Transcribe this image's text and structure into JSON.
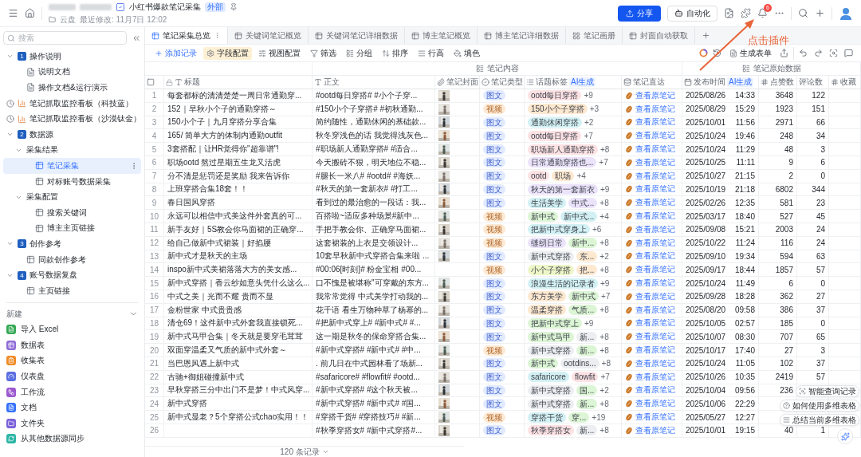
{
  "header": {
    "title": "小红书爆款笔记采集",
    "badge": "外部",
    "location": "云盘",
    "modified": "最近修改: 11月7日 12:02",
    "share": "分享",
    "automation": "自动化",
    "notifications": "6"
  },
  "annotation": {
    "text": "点击插件"
  },
  "sidebar": {
    "search": {
      "placeholder": "搜索"
    },
    "tree": [
      {
        "kind": "section",
        "number": "1",
        "label": "操作说明",
        "expanded": true,
        "selected": false,
        "children": [
          {
            "kind": "doc",
            "label": "说明文档",
            "selected": false
          },
          {
            "kind": "doc",
            "label": "操作文档&运行演示",
            "selected": false
          }
        ]
      },
      {
        "kind": "dashboard",
        "label": "笔记抓取监控看板（科技蓝）",
        "selected": false
      },
      {
        "kind": "dashboard",
        "label": "笔记抓取监控看板（沙漠钛金）",
        "selected": false
      },
      {
        "kind": "section",
        "number": "2",
        "label": "数据源",
        "expanded": true,
        "selected": false,
        "children": [
          {
            "kind": "folder",
            "label": "采集结果",
            "expanded": true,
            "selected": false,
            "children": [
              {
                "kind": "table",
                "label": "笔记采集",
                "selected": true
              },
              {
                "kind": "table",
                "label": "对标账号数据采集",
                "selected": false
              }
            ]
          },
          {
            "kind": "folder",
            "label": "采集配置",
            "expanded": true,
            "selected": false,
            "children": [
              {
                "kind": "table",
                "label": "搜索关键词",
                "selected": false
              },
              {
                "kind": "table",
                "label": "博主主页链接",
                "selected": false
              }
            ]
          }
        ]
      },
      {
        "kind": "section",
        "number": "3",
        "label": "创作参考",
        "expanded": true,
        "selected": false,
        "children": [
          {
            "kind": "table",
            "label": "同款创作参考",
            "selected": false
          }
        ]
      },
      {
        "kind": "section",
        "number": "4",
        "label": "账号数据复盘",
        "expanded": true,
        "selected": false,
        "children": [
          {
            "kind": "table",
            "label": "主页链接",
            "selected": false
          }
        ]
      }
    ],
    "new_section": {
      "title": "新建",
      "items": [
        {
          "kind": "excel",
          "label": "导入 Excel",
          "color": "#34a853"
        },
        {
          "kind": "table",
          "label": "数据表",
          "color": "#8e6bd8"
        },
        {
          "kind": "form",
          "label": "收集表",
          "color": "#f08a24"
        },
        {
          "kind": "dashboard",
          "label": "仪表盘",
          "color": "#5b6ee1"
        },
        {
          "kind": "workflow",
          "label": "工作流",
          "color": "#9b59d0"
        },
        {
          "kind": "doc",
          "label": "文档",
          "color": "#3370ff"
        },
        {
          "kind": "folder",
          "label": "文件夹",
          "color": "#7b61d9"
        },
        {
          "kind": "sync",
          "label": "从其他数据源同步",
          "color": "#2bb5a5"
        }
      ]
    }
  },
  "tabs": [
    {
      "kind": "table",
      "label": "笔记采集总览",
      "selected": true
    },
    {
      "kind": "table",
      "label": "关键词笔记概览",
      "selected": false
    },
    {
      "kind": "table",
      "label": "关键词笔记详细数据",
      "selected": false
    },
    {
      "kind": "table",
      "label": "博主笔记概览",
      "selected": false
    },
    {
      "kind": "table",
      "label": "博主笔记详细数据",
      "selected": false
    },
    {
      "kind": "gallery",
      "label": "笔记画册",
      "selected": false
    },
    {
      "kind": "table",
      "label": "封面自动获取",
      "selected": false
    }
  ],
  "toolbar": {
    "items": [
      {
        "kind": "add",
        "label": "添加记录",
        "active": false
      },
      {
        "kind": "fields",
        "label": "字段配置",
        "active": true
      },
      {
        "kind": "view",
        "label": "视图配置",
        "active": false
      },
      {
        "kind": "filter",
        "label": "筛选",
        "active": false
      },
      {
        "kind": "group",
        "label": "分组",
        "active": false
      },
      {
        "kind": "sort",
        "label": "排序",
        "active": false
      },
      {
        "kind": "row_height",
        "label": "行高",
        "active": false
      },
      {
        "kind": "fill",
        "label": "填色",
        "active": false
      }
    ],
    "generate_form": "生成表单"
  },
  "table": {
    "header_checkbox": {
      "checked": false
    },
    "groups": [
      {
        "label": "笔记内容"
      },
      {
        "label": "笔记原始数据"
      }
    ],
    "columns": [
      {
        "kind": "title",
        "label": "标题"
      },
      {
        "kind": "text",
        "label": "正文"
      },
      {
        "kind": "attachment",
        "label": "笔记封面"
      },
      {
        "kind": "select",
        "label": "笔记类型"
      },
      {
        "kind": "multi",
        "label": "话题标签",
        "ai": "AI生成"
      },
      {
        "kind": "formula",
        "label": "笔记直达"
      },
      {
        "kind": "date",
        "label": "发布时间",
        "ai": "AI生成"
      },
      {
        "kind": "number",
        "label": "点赞数"
      },
      {
        "kind": "plain",
        "label": "评论数"
      },
      {
        "kind": "number",
        "label": "收藏"
      }
    ],
    "rows": [
      {
        "no": "1",
        "title": "每套都标的清清楚楚一周日常通勤穿...",
        "body": "#ootd每日穿搭# #小个子穿...",
        "cover": {
          "kind": "picture"
        },
        "type": {
          "kind": "image_text",
          "label": "图文"
        },
        "tags": [
          {
            "label": "ootd每日穿搭",
            "color": "#fde2e4"
          }
        ],
        "more": "+9",
        "link": "查看原笔记",
        "date": "2025/08/26",
        "time": "14:33",
        "likes": "3648",
        "comments": "122"
      },
      {
        "no": "2",
        "title": "152｜早秋小个子的通勤穿搭～",
        "body": "#150小个子穿搭# #初秋通勤...",
        "cover": {
          "kind": "picture"
        },
        "type": {
          "kind": "video",
          "label": "视频"
        },
        "tags": [
          {
            "label": "150小个子穿搭",
            "color": "#fde8d0"
          }
        ],
        "more": "+3",
        "link": "查看原笔记",
        "date": "2025/08/29",
        "time": "15:29",
        "likes": "1923",
        "comments": "151"
      },
      {
        "no": "3",
        "title": "150小个子｜九月穿搭分享合集",
        "body": "简约随性，通勤休闲的基础款...",
        "cover": {
          "kind": "picture"
        },
        "type": {
          "kind": "image_text",
          "label": "图文"
        },
        "tags": [
          {
            "label": "通勤休闲穿搭",
            "color": "#d3f1f4"
          }
        ],
        "more": "+2",
        "link": "查看原笔记",
        "date": "2025/10/01",
        "time": "11:56",
        "likes": "2971",
        "comments": "66"
      },
      {
        "no": "4",
        "title": "165/ 简单大方的体制内通勤outfit",
        "body": "秋冬穿浅色的话 我觉得浅灰色...",
        "cover": {
          "kind": "picture"
        },
        "type": {
          "kind": "image_text",
          "label": "图文"
        },
        "tags": [
          {
            "label": "ootd每日穿搭",
            "color": "#fde2e4"
          }
        ],
        "more": "+7",
        "link": "查看原笔记",
        "date": "2025/10/24",
        "time": "19:46",
        "likes": "248",
        "comments": "34"
      },
      {
        "no": "5",
        "title": "3套搭配｜让HR觉得你\"超靠谱\"!",
        "body": "#职场新人通勤穿搭# #适合...",
        "cover": {
          "kind": "picture"
        },
        "type": {
          "kind": "image_text",
          "label": "图文"
        },
        "tags": [
          {
            "label": "职场新人通勤穿搭",
            "color": "#fde2e4"
          }
        ],
        "more": "+8",
        "link": "查看原笔记",
        "date": "2025/10/24",
        "time": "11:29",
        "likes": "48",
        "comments": "3"
      },
      {
        "no": "6",
        "title": "职场ootd 熬过星期五生龙又活虎",
        "body": "今天搬砖不狠，明天地位不稳...",
        "cover": {
          "kind": "picture"
        },
        "type": {
          "kind": "image_text",
          "label": "图文"
        },
        "tags": [
          {
            "label": "日常通勤穿搭也...",
            "color": "#ebe3fa"
          }
        ],
        "more": "+7",
        "link": "查看原笔记",
        "date": "2025/10/25",
        "time": "11:11",
        "likes": "9",
        "comments": "6"
      },
      {
        "no": "7",
        "title": "分不清是惩罚还是奖励 我来告诉你",
        "body": "#腿长一米八# #ootd# #海妖...",
        "cover": {
          "kind": "picture"
        },
        "type": {
          "kind": "image_text",
          "label": "图文"
        },
        "tags": [
          {
            "label": "ootd",
            "color": "#fde2e4"
          },
          {
            "label": "职场",
            "color": "#fde8d0"
          }
        ],
        "more": "+4",
        "link": "查看原笔记",
        "date": "2025/10/27",
        "time": "21:15",
        "likes": "2",
        "comments": "0"
      },
      {
        "no": "8",
        "title": "上班穿搭合集18套！！",
        "body": "#秋天的第一套新衣# #打工...",
        "cover": {
          "kind": "picture"
        },
        "type": {
          "kind": "image_text",
          "label": "图文"
        },
        "tags": [
          {
            "label": "秋天的第一套新衣",
            "color": "#ebe3fa"
          }
        ],
        "more": "+9",
        "link": "查看原笔记",
        "date": "2025/10/19",
        "time": "21:18",
        "likes": "6802",
        "comments": "344"
      },
      {
        "no": "9",
        "title": "春日国风穿搭",
        "body": "看到过的最治愈的一段话：我...",
        "cover": {
          "kind": "picture"
        },
        "type": {
          "kind": "image_text",
          "label": "图文"
        },
        "tags": [
          {
            "label": "生活美学",
            "color": "#d3f1f4"
          },
          {
            "label": "中式...",
            "color": "#ebe3fa"
          }
        ],
        "more": "+8",
        "link": "查看原笔记",
        "date": "2025/02/26",
        "time": "12:35",
        "likes": "581",
        "comments": "23"
      },
      {
        "no": "10",
        "title": "永远可以相信中式美这件外套真的可...",
        "body": "百搭啦~适应多种场景#新中...",
        "cover": {
          "kind": "picture"
        },
        "type": {
          "kind": "video",
          "label": "视频"
        },
        "tags": [
          {
            "label": "新中式",
            "color": "#dcf5d5"
          },
          {
            "label": "新中式...",
            "color": "#d3f1f4"
          }
        ],
        "more": "+4",
        "link": "查看原笔记",
        "date": "2025/03/17",
        "time": "18:40",
        "likes": "527",
        "comments": "45"
      },
      {
        "no": "11",
        "title": "新手友好｜5S教会你马面裙的正确穿...",
        "body": "手把手教会你、正确穿马面裙...",
        "cover": {
          "kind": "picture"
        },
        "type": {
          "kind": "video",
          "label": "视频"
        },
        "tags": [
          {
            "label": "把新中式穿身上",
            "color": "#d3f1f4"
          }
        ],
        "more": "+6",
        "link": "查看原笔记",
        "date": "2025/09/08",
        "time": "15:21",
        "likes": "2003",
        "comments": "24"
      },
      {
        "no": "12",
        "title": "给自己做新中式裙装｜好掐腰",
        "body": "这套裙装的上衣是交领设计...",
        "cover": {
          "kind": "picture"
        },
        "type": {
          "kind": "video",
          "label": "视频"
        },
        "tags": [
          {
            "label": "缝纫日常",
            "color": "#ebe3fa"
          },
          {
            "label": "新中...",
            "color": "#dcf5d5"
          }
        ],
        "more": "+8",
        "link": "查看原笔记",
        "date": "2025/10/22",
        "time": "11:24",
        "likes": "116",
        "comments": "24"
      },
      {
        "no": "13",
        "title": "新中式才是秋天的主场",
        "body": "10套早秋新中式穿搭合集来啦 ...",
        "cover": {
          "kind": "picture"
        },
        "type": {
          "kind": "image_text",
          "label": "图文"
        },
        "tags": [
          {
            "label": "新中式穿搭",
            "color": "#eceef1"
          },
          {
            "label": "东...",
            "color": "#fde8d0"
          }
        ],
        "more": "+2",
        "link": "查看原笔记",
        "date": "2025/09/10",
        "time": "19:34",
        "likes": "594",
        "comments": "63"
      },
      {
        "no": "14",
        "title": "inspo新中式美裙落落大方的美女感...",
        "body": "#00:06[时刻]# 粉金宝相 #00...",
        "type": {
          "kind": "video",
          "label": "视频"
        },
        "tags": [
          {
            "label": "小个子穿搭",
            "color": "#eef6c8"
          },
          {
            "label": "把...",
            "color": "#fde8d0"
          }
        ],
        "more": "+8",
        "link": "查看原笔记",
        "date": "2025/09/17",
        "time": "18:44",
        "likes": "1857",
        "comments": "57"
      },
      {
        "no": "15",
        "title": "新中式穿搭｜香云纱如意头凭什么这么...",
        "body": "口不愧是被堪称\"可穿戴的东方...",
        "cover": {
          "kind": "picture"
        },
        "type": {
          "kind": "image_text",
          "label": "图文"
        },
        "tags": [
          {
            "label": "浪漫生活的记录者",
            "color": "#d3f1f4"
          }
        ],
        "more": "+9",
        "link": "查看原笔记",
        "date": "2025/10/24",
        "time": "11:49",
        "likes": "6",
        "comments": "0"
      },
      {
        "no": "16",
        "title": "中式之美｜光而不耀 贵而不显",
        "body": "我常常觉得 中式美学打动我的...",
        "cover": {
          "kind": "picture"
        },
        "type": {
          "kind": "image_text",
          "label": "图文"
        },
        "tags": [
          {
            "label": "东方美学",
            "color": "#fde8d0"
          },
          {
            "label": "新中式",
            "color": "#dcf5d5"
          }
        ],
        "more": "+7",
        "link": "查看原笔记",
        "date": "2025/09/28",
        "time": "18:28",
        "likes": "362",
        "comments": "27"
      },
      {
        "no": "17",
        "title": "金粉世家 中式贵贵感",
        "body": "花千语 看生万物种草了杨幂的...",
        "cover": {
          "kind": "picture"
        },
        "type": {
          "kind": "image_text",
          "label": "图文"
        },
        "tags": [
          {
            "label": "温柔穿搭",
            "color": "#fde8d0"
          },
          {
            "label": "气质...",
            "color": "#dcf5d5"
          }
        ],
        "more": "+8",
        "link": "查看原笔记",
        "date": "2025/08/20",
        "time": "09:58",
        "likes": "386",
        "comments": "37"
      },
      {
        "no": "18",
        "title": "清仓69！这件新中式外套我直接锁死...",
        "body": "#把新中式穿上# #新中式# #...",
        "cover": {
          "kind": "picture"
        },
        "type": {
          "kind": "image_text",
          "label": "图文"
        },
        "tags": [
          {
            "label": "把新中式穿上",
            "color": "#dcf5d5"
          }
        ],
        "more": "+9",
        "link": "查看原笔记",
        "date": "2025/10/05",
        "time": "02:57",
        "likes": "185",
        "comments": "0"
      },
      {
        "no": "19",
        "title": "新中式马甲合集｜冬天就是要穿毛茸茸",
        "body": "这一期是秋冬的保命穿搭合集...",
        "cover": {
          "kind": "picture"
        },
        "type": {
          "kind": "image_text",
          "label": "图文"
        },
        "tags": [
          {
            "label": "新中式马甲",
            "color": "#dcf5d5"
          },
          {
            "label": "新...",
            "color": "#eceef1"
          }
        ],
        "more": "+8",
        "link": "查看原笔记",
        "date": "2025/10/07",
        "time": "08:30",
        "likes": "707",
        "comments": "65"
      },
      {
        "no": "20",
        "title": "双面穿温柔又气质的新中式外套～",
        "body": "#新中式穿搭# #新中式# #中...",
        "cover": {
          "kind": "picture"
        },
        "type": {
          "kind": "video",
          "label": "视频"
        },
        "tags": [
          {
            "label": "新中式穿搭",
            "color": "#eceef1"
          },
          {
            "label": "新...",
            "color": "#dcf5d5"
          }
        ],
        "more": "+8",
        "link": "查看原笔记",
        "date": "2025/10/17",
        "time": "17:40",
        "likes": "27",
        "comments": "3"
      },
      {
        "no": "21",
        "title": "当巴恩风遇上新中式",
        "body": ". 前几日在中式园林看了场新...",
        "cover": {
          "kind": "picture"
        },
        "type": {
          "kind": "image_text",
          "label": "图文"
        },
        "tags": [
          {
            "label": "新中式",
            "color": "#dcf5d5"
          },
          {
            "label": "ootdins...",
            "color": "#eceef1"
          }
        ],
        "more": "+8",
        "link": "查看原笔记",
        "date": "2025/10/24",
        "time": "11:05",
        "likes": "102",
        "comments": "37"
      },
      {
        "no": "22",
        "title": "古驰+御姐碰撞新中式",
        "body": "#safaricore# #flowfit# #ootd...",
        "cover": {
          "kind": "picture"
        },
        "type": {
          "kind": "image_text",
          "label": "图文"
        },
        "tags": [
          {
            "label": "safaricore",
            "color": "#d3f1f4"
          },
          {
            "label": "flowfit",
            "color": "#fde2e4"
          }
        ],
        "more": "+7",
        "link": "查看原笔记",
        "date": "2025/10/26",
        "time": "10:35",
        "likes": "2419",
        "comments": "57"
      },
      {
        "no": "23",
        "title": "早秋穿搭三分中出门不是梦！中式风穿...",
        "body": "#新中式穿搭# #这个秋天被...",
        "cover": {
          "kind": "picture"
        },
        "type": {
          "kind": "image_text",
          "label": "图文"
        },
        "tags": [
          {
            "label": "新中式穿搭",
            "color": "#eceef1"
          },
          {
            "label": "国...",
            "color": "#dcf5d5"
          }
        ],
        "more": "+2",
        "link": "查看原笔记",
        "date": "2025/10/04",
        "time": "09:56",
        "likes": "236"
      },
      {
        "no": "24",
        "title": "新中式穿搭",
        "body": "#新中式穿搭# #新中式# #国...",
        "cover": {
          "kind": "picture"
        },
        "type": {
          "kind": "image_text",
          "label": "图文"
        },
        "tags": [
          {
            "label": "新中式穿搭",
            "color": "#eceef1"
          },
          {
            "label": "新...",
            "color": "#dcf5d5"
          }
        ],
        "more": "+8",
        "link": "查看原笔记",
        "date": "2025/10/06",
        "time": "22:29"
      },
      {
        "no": "25",
        "title": "新中式显老？5个穿搭公式chao实用！！",
        "body": "#穿搭干货# #穿搭技巧# #新...",
        "cover": {
          "kind": "picture"
        },
        "type": {
          "kind": "video",
          "label": "视频"
        },
        "tags": [
          {
            "label": "穿搭干货",
            "color": "#d3f1f4"
          },
          {
            "label": "穿...",
            "color": "#dcf5d5"
          }
        ],
        "more": "+19",
        "link": "查看原笔记",
        "date": "2025/05/27",
        "time": "12:27"
      },
      {
        "no": "26",
        "body": "#秋季穿搭女# #新中式穿搭#...",
        "cover": {
          "kind": "picture"
        },
        "type": {
          "kind": "image_text",
          "label": "图文"
        },
        "tags": [
          {
            "label": "秋季穿搭女",
            "color": "#fde2e4"
          },
          {
            "label": "新...",
            "color": "#eceef1"
          }
        ],
        "more": "+8",
        "link": "查看原笔记",
        "date": "2025/10/01",
        "time": "19:15",
        "likes": "40",
        "comments": "1"
      }
    ],
    "record_count": "120 条记录"
  },
  "assistant": {
    "suggestions": [
      {
        "kind": "query",
        "label": "智能查询记录"
      },
      {
        "kind": "help",
        "label": "如何使用多维表格"
      },
      {
        "kind": "summary",
        "label": "总结当前多维表格"
      }
    ]
  }
}
